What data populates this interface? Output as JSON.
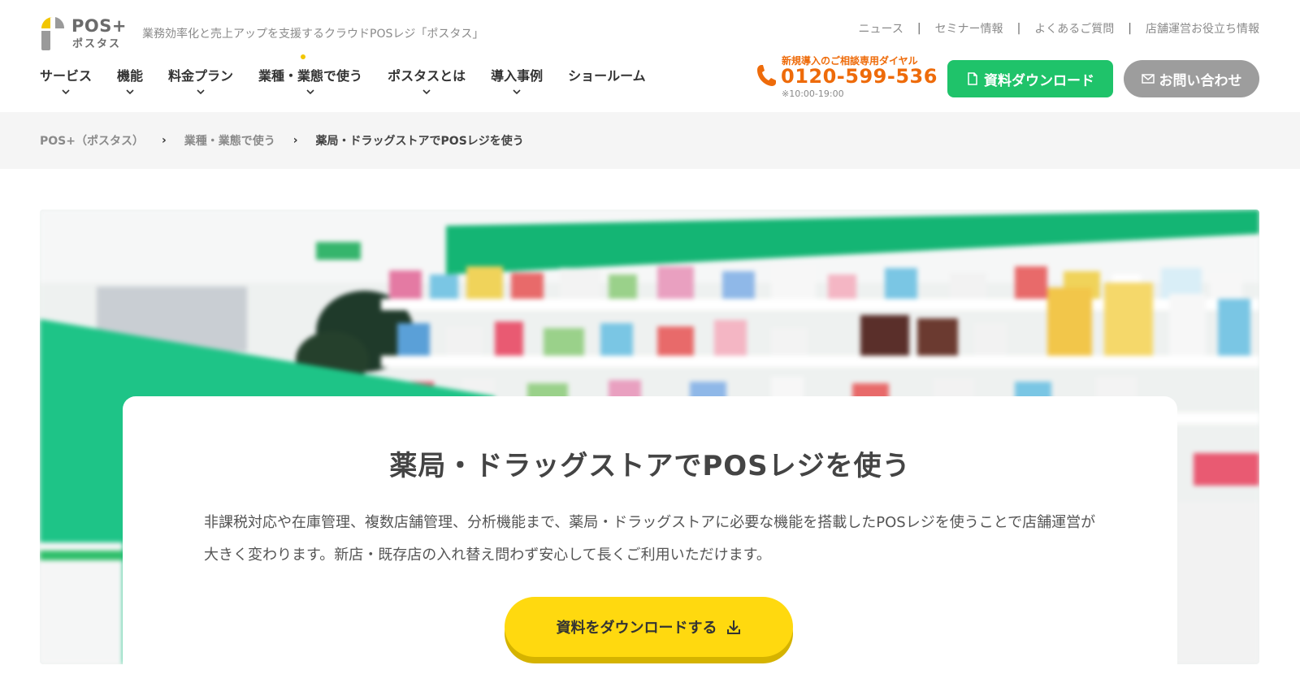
{
  "brand": {
    "logo_main": "POS+",
    "logo_sub": "ポスタス",
    "tagline": "業務効率化と売上アップを支援するクラウドPOSレジ「ポスタス」",
    "colors": {
      "green": "#1fc36a",
      "yellow": "#ffd90f",
      "orange": "#ee6b0a",
      "gray": "#9d9d9d"
    }
  },
  "top_links": [
    "ニュース",
    "セミナー情報",
    "よくあるご質問",
    "店舗運営お役立ち情報"
  ],
  "top_links_separator": "|",
  "gnav": [
    {
      "label": "サービス",
      "has_dropdown": true
    },
    {
      "label": "機能",
      "has_dropdown": true
    },
    {
      "label": "料金プラン",
      "has_dropdown": true
    },
    {
      "label": "業種・業態で使う",
      "has_dropdown": true,
      "active": true
    },
    {
      "label": "ポスタスとは",
      "has_dropdown": true
    },
    {
      "label": "導入事例",
      "has_dropdown": true
    },
    {
      "label": "ショールーム",
      "has_dropdown": false
    }
  ],
  "tel": {
    "label": "新規導入のご相談専用ダイヤル",
    "number": "0120-599-536",
    "hours": "※10:00-19:00",
    "icon": "phone-icon"
  },
  "buttons": {
    "download": "資料ダウンロード",
    "contact": "お問い合わせ"
  },
  "breadcrumb": {
    "items": [
      "POS+（ポスタス）",
      "業種・業態で使う"
    ],
    "separator": "›",
    "current": "薬局・ドラッグストアでPOSレジを使う"
  },
  "hero": {
    "title": "薬局・ドラッグストアでPOSレジを使う",
    "description": "非課税対応や在庫管理、複数店舗管理、分析機能まで、薬局・ドラッグストアに必要な機能を搭載したPOSレジを使うことで店舗運営が大きく変わります。新店・既存店の入れ替え問わず安心して長くご利用いただけます。",
    "cta": "資料をダウンロードする"
  }
}
